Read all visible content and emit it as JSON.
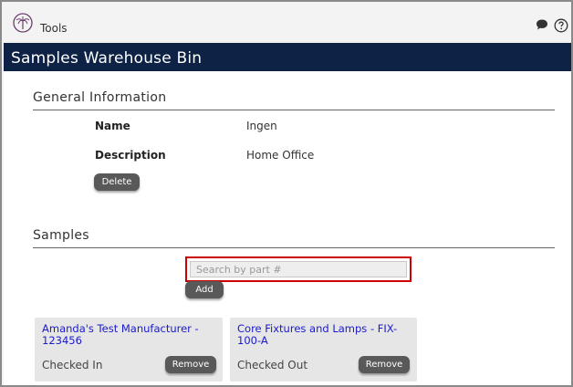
{
  "header": {
    "tools_label": "Tools",
    "logo_icon": "palm-tree-logo-icon",
    "chat_icon": "chat-bubble-icon",
    "help_icon": "help-icon"
  },
  "page_title": "Samples Warehouse Bin",
  "general": {
    "title": "General Information",
    "name_label": "Name",
    "name_value": "Ingen",
    "description_label": "Description",
    "description_value": "Home Office",
    "delete_label": "Delete"
  },
  "samples": {
    "title": "Samples",
    "search_placeholder": "Search by part #",
    "add_label": "Add",
    "cards": [
      {
        "title": "Amanda's Test Manufacturer - 123456",
        "status": "Checked In",
        "remove_label": "Remove"
      },
      {
        "title": "Core Fixtures and Lamps - FIX-100-A",
        "status": "Checked Out",
        "remove_label": "Remove"
      }
    ]
  },
  "colors": {
    "title_bar": "#0d2244",
    "button": "#595959",
    "link": "#1a1acc",
    "highlight": "#cc0000"
  }
}
